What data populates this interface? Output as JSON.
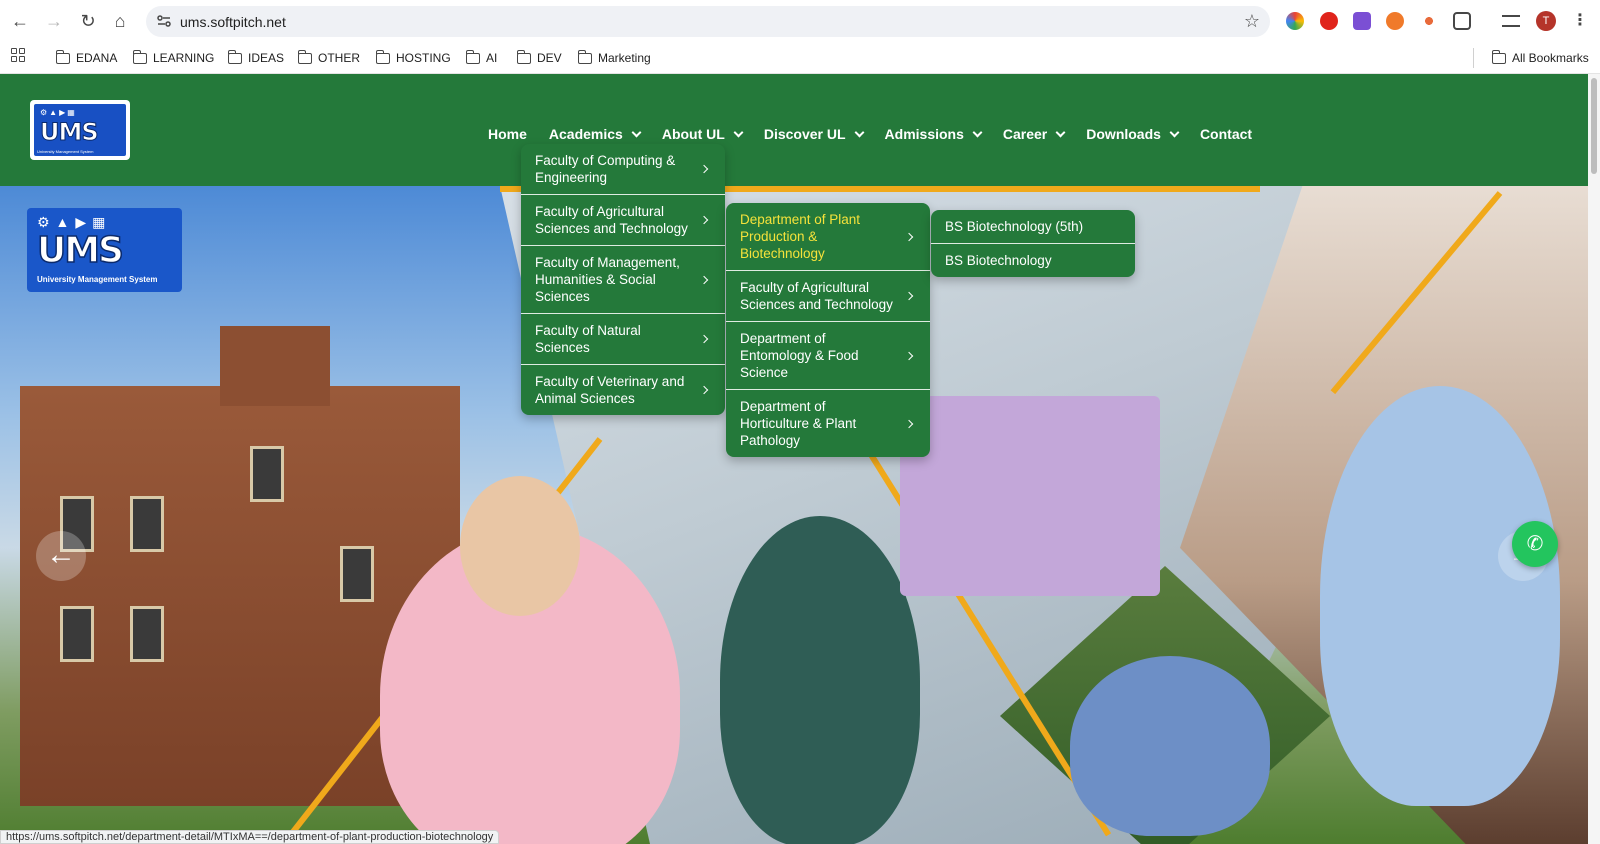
{
  "browser": {
    "url": "ums.softpitch.net",
    "status_url": "https://ums.softpitch.net/department-detail/MTIxMA==/department-of-plant-production-biotechnology",
    "profile_initial": "T",
    "bookmarks": [
      "EDANA",
      "LEARNING",
      "IDEAS",
      "OTHER",
      "HOSTING",
      "AI",
      "DEV",
      "Marketing"
    ],
    "all_bookmarks": "All Bookmarks"
  },
  "site": {
    "nav": [
      {
        "label": "Home"
      },
      {
        "label": "Academics"
      },
      {
        "label": "About UL"
      },
      {
        "label": "Discover UL"
      },
      {
        "label": "Admissions"
      },
      {
        "label": "Career"
      },
      {
        "label": "Downloads"
      },
      {
        "label": "Contact"
      }
    ],
    "logo_text": "UMS",
    "logo_subtitle": "University Management System",
    "colors": {
      "brand_green": "#24793a",
      "accent_gold": "#f0a91b",
      "active_yellow": "#f5e23b"
    }
  },
  "menu_faculties": [
    {
      "label": "Faculty of Computing & Engineering"
    },
    {
      "label": "Faculty of Agricultural Sciences and Technology"
    },
    {
      "label": "Faculty of Management, Humanities & Social Sciences"
    },
    {
      "label": "Faculty of Natural Sciences"
    },
    {
      "label": "Faculty of Veterinary and Animal Sciences"
    }
  ],
  "menu_departments": [
    {
      "label": "Department of Plant Production & Biotechnology"
    },
    {
      "label": "Faculty of Agricultural Sciences and Technology"
    },
    {
      "label": "Department of Entomology & Food Science"
    },
    {
      "label": "Department of Horticulture & Plant Pathology"
    }
  ],
  "menu_programs": [
    {
      "label": "BS Biotechnology (5th)"
    },
    {
      "label": "BS Biotechnology"
    }
  ]
}
